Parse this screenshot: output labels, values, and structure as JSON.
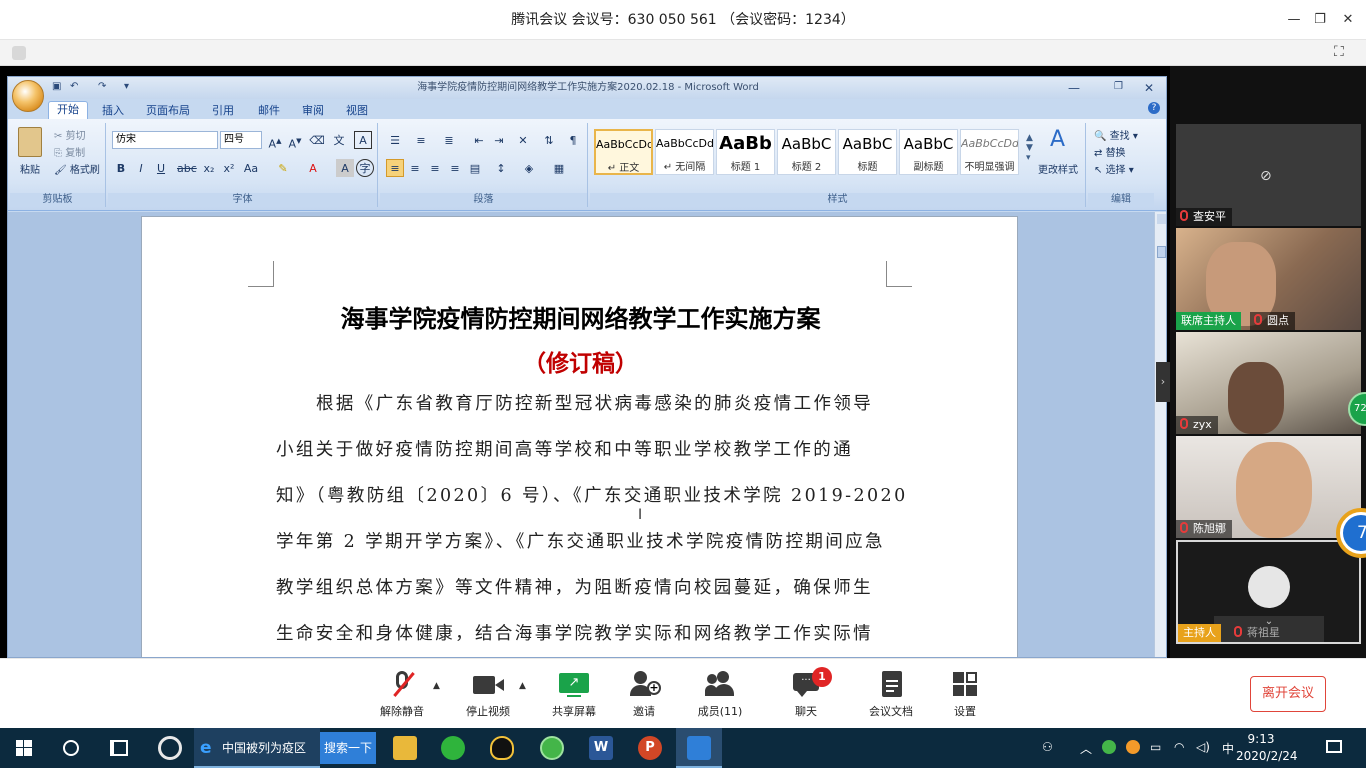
{
  "meeting": {
    "title": "腾讯会议 会议号：630 050 561 （会议密码：1234）"
  },
  "word": {
    "window_title": "海事学院疫情防控期间网络教学工作实施方案2020.02.18 - Microsoft Word",
    "tabs": [
      "开始",
      "插入",
      "页面布局",
      "引用",
      "邮件",
      "审阅",
      "视图"
    ],
    "clipboard": {
      "paste": "粘贴",
      "cut": "剪切",
      "copy": "复制",
      "format_painter": "格式刷",
      "group": "剪贴板"
    },
    "font": {
      "name": "仿宋",
      "size": "四号",
      "group": "字体",
      "bold": "B",
      "italic": "I",
      "underline": "U"
    },
    "paragraph": {
      "group": "段落"
    },
    "styles": {
      "group": "样式",
      "items": [
        {
          "sample": "AaBbCcDd",
          "name": "↵ 正文"
        },
        {
          "sample": "AaBbCcDd",
          "name": "↵ 无间隔"
        },
        {
          "sample": "AaBb",
          "name": "标题 1"
        },
        {
          "sample": "AaBbC",
          "name": "标题 2"
        },
        {
          "sample": "AaBbC",
          "name": "标题"
        },
        {
          "sample": "AaBbC",
          "name": "副标题"
        },
        {
          "sample": "AaBbCcDd",
          "name": "不明显强调"
        }
      ],
      "change": "更改样式"
    },
    "editing": {
      "find": "查找",
      "replace": "替换",
      "select": "选择",
      "group": "编辑"
    },
    "document": {
      "title": "海事学院疫情防控期间网络教学工作实施方案",
      "subtitle": "（修订稿）",
      "lines": [
        "根据《广东省教育厅防控新型冠状病毒感染的肺炎疫情工作领导",
        "小组关于做好疫情防控期间高等学校和中等职业学校教学工作的通",
        "知》（粤教防组〔2020〕6 号）、《广东交通职业技术学院 2019-2020",
        "学年第 2 学期开学方案》、《广东交通职业技术学院疫情防控期间应急",
        "教学组织总体方案》等文件精神，为阻断疫情向校园蔓延，确保师生",
        "生命安全和身体健康，结合海事学院教学实际和网络教学工作实际情"
      ]
    }
  },
  "participants": [
    {
      "name": "查安平",
      "host_tag": ""
    },
    {
      "name": "圆点",
      "host_tag": "联席主持人"
    },
    {
      "name": "zyx",
      "host_tag": ""
    },
    {
      "name": "陈旭娜",
      "host_tag": ""
    },
    {
      "name": "蒋祖星",
      "host_tag": "主持人"
    }
  ],
  "side_badges": {
    "top": "72",
    "bottom": "7"
  },
  "toolbar": {
    "unmute": "解除静音",
    "stop_video": "停止视频",
    "share": "共享屏幕",
    "invite": "邀请",
    "members": "成员(11)",
    "chat": "聊天",
    "chat_badge": "1",
    "docs": "会议文档",
    "settings": "设置",
    "leave": "离开会议"
  },
  "taskbar": {
    "ie_title": "中国被列为疫区",
    "search_button": "搜索一下",
    "ime": "中",
    "time": "9:13",
    "date": "2020/2/24"
  },
  "colors": {
    "accent_green": "#1aa34a",
    "leave_red": "#e0453a",
    "title_red": "#c00000",
    "taskbar": "#0c2a3e"
  }
}
